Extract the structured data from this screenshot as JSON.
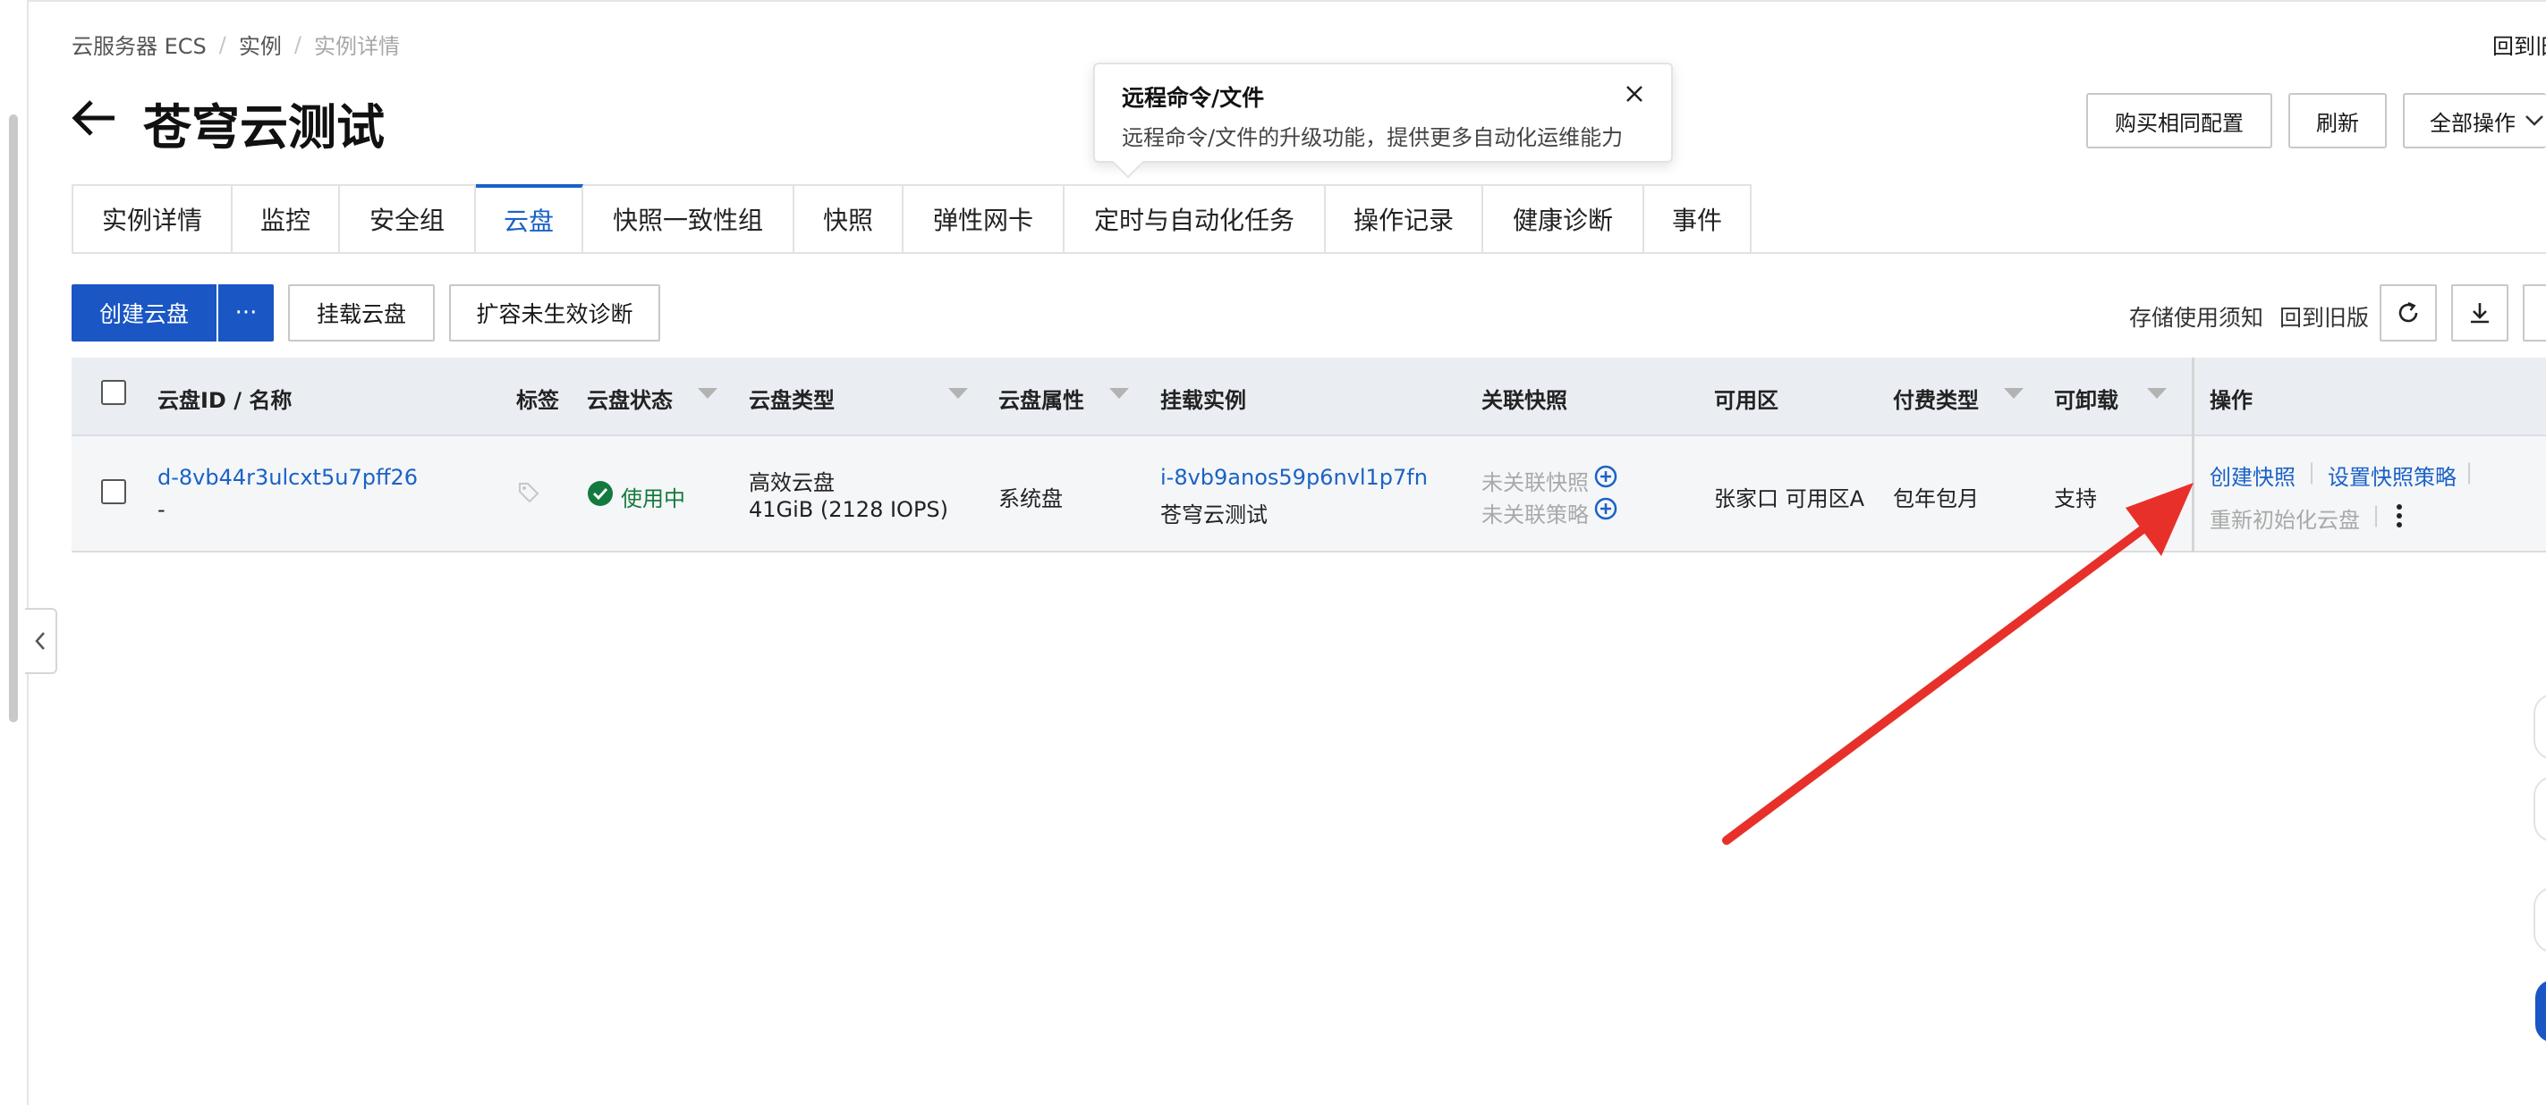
{
  "breadcrumb": {
    "item1": "云服务器 ECS",
    "item2": "实例",
    "item3": "实例详情",
    "separator": "/"
  },
  "top_right_partial": "回到旧",
  "page": {
    "title": "苍穹云测试"
  },
  "header_buttons": {
    "buy_same": "购买相同配置",
    "refresh": "刷新",
    "all_actions": "全部操作"
  },
  "popover": {
    "title": "远程命令/文件",
    "description": "远程命令/文件的升级功能，提供更多自动化运维能力"
  },
  "tabs": [
    {
      "label": "实例详情"
    },
    {
      "label": "监控"
    },
    {
      "label": "安全组"
    },
    {
      "label": "云盘"
    },
    {
      "label": "快照一致性组"
    },
    {
      "label": "快照"
    },
    {
      "label": "弹性网卡"
    },
    {
      "label": "定时与自动化任务"
    },
    {
      "label": "操作记录"
    },
    {
      "label": "健康诊断"
    },
    {
      "label": "事件"
    }
  ],
  "active_tab": "云盘",
  "toolbar": {
    "create_disk": "创建云盘",
    "more": "···",
    "attach_disk": "挂载云盘",
    "expand_diagnose": "扩容未生效诊断",
    "storage_notice": "存储使用须知",
    "back_old": "回到旧版"
  },
  "table": {
    "headers": {
      "disk_id_name": "云盘ID / 名称",
      "tags": "标签",
      "status": "云盘状态",
      "type": "云盘类型",
      "attribute": "云盘属性",
      "instance": "挂载实例",
      "snapshot": "关联快照",
      "zone": "可用区",
      "billing": "付费类型",
      "detachable": "可卸载",
      "actions": "操作"
    },
    "rows": [
      {
        "disk_id": "d-8vb44r3ulcxt5u7pff26",
        "name": "-",
        "status": "使用中",
        "type_line1": "高效云盘",
        "type_line2": "41GiB (2128 IOPS)",
        "attribute": "系统盘",
        "instance_id": "i-8vb9anos59p6nvl1p7fn",
        "instance_name": "苍穹云测试",
        "snapshot_line1": "未关联快照",
        "snapshot_line2": "未关联策略",
        "zone": "张家口 可用区A",
        "billing": "包年包月",
        "detachable": "支持",
        "action_create_snapshot": "创建快照",
        "action_snapshot_policy": "设置快照策略",
        "action_reinit": "重新初始化云盘"
      }
    ]
  },
  "colors": {
    "primary": "#1a56c4",
    "link": "#1a62c6",
    "success": "#137a3e",
    "annotation_arrow": "#e8302a"
  }
}
